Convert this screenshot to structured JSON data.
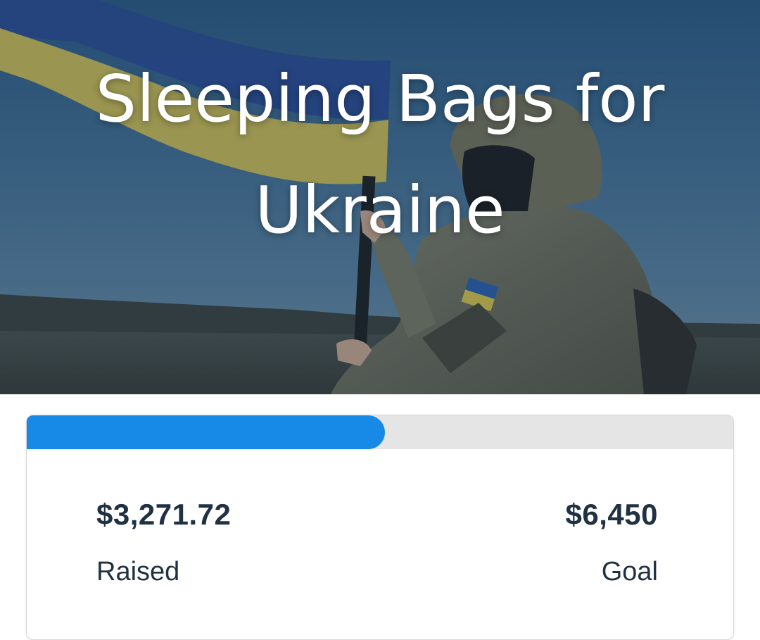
{
  "campaign": {
    "title": "Sleeping Bags for Ukraine"
  },
  "progress": {
    "raised": "$3,271.72",
    "raised_label": "Raised",
    "goal": "$6,450",
    "goal_label": "Goal",
    "fraction": 0.507
  },
  "colors": {
    "progress_fill": "#1789e6",
    "progress_track": "#e5e5e5",
    "stat_text": "#1f3142"
  }
}
